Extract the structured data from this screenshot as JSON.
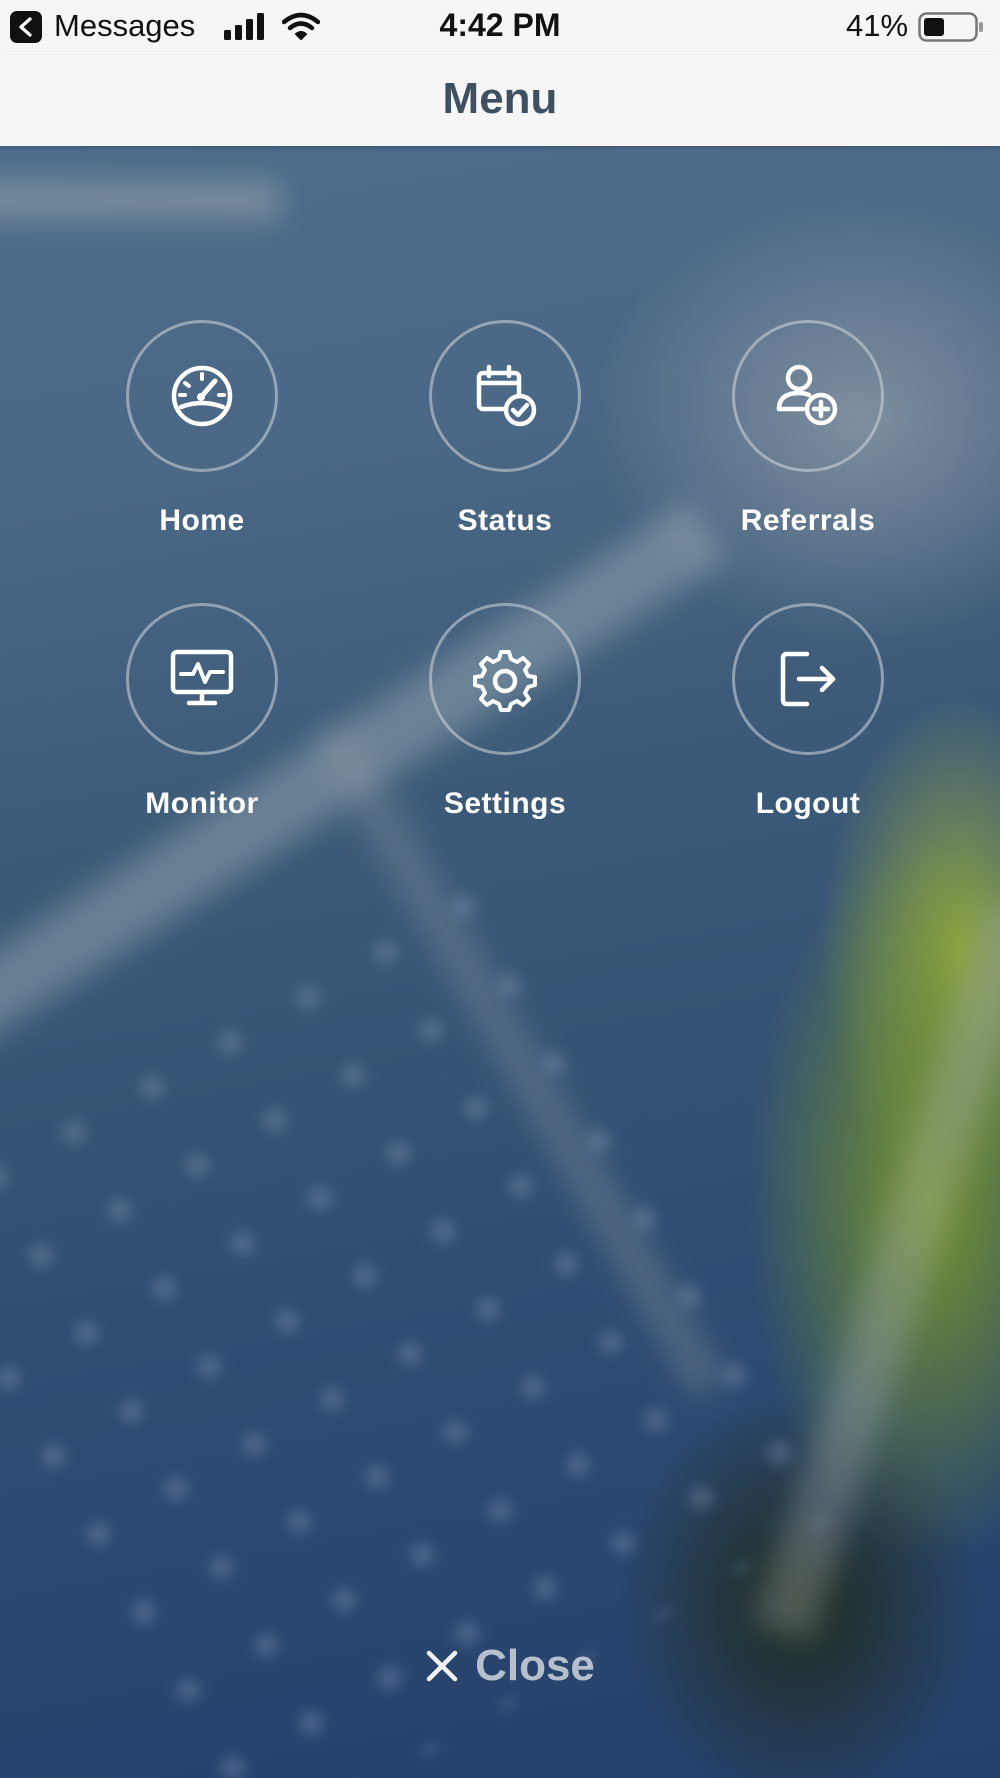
{
  "status_bar": {
    "back_app": "Messages",
    "time": "4:42 PM",
    "battery_percent": "41%",
    "battery_level": 0.41,
    "signal_bars": 4
  },
  "header": {
    "title": "Menu"
  },
  "menu": {
    "items": [
      {
        "label": "Home",
        "icon": "speedometer-icon"
      },
      {
        "label": "Status",
        "icon": "calendar-check-icon"
      },
      {
        "label": "Referrals",
        "icon": "user-add-icon"
      },
      {
        "label": "Monitor",
        "icon": "monitor-pulse-icon"
      },
      {
        "label": "Settings",
        "icon": "gear-icon"
      },
      {
        "label": "Logout",
        "icon": "logout-icon"
      }
    ]
  },
  "footer": {
    "close_label": "Close",
    "close_icon": "close-icon"
  }
}
